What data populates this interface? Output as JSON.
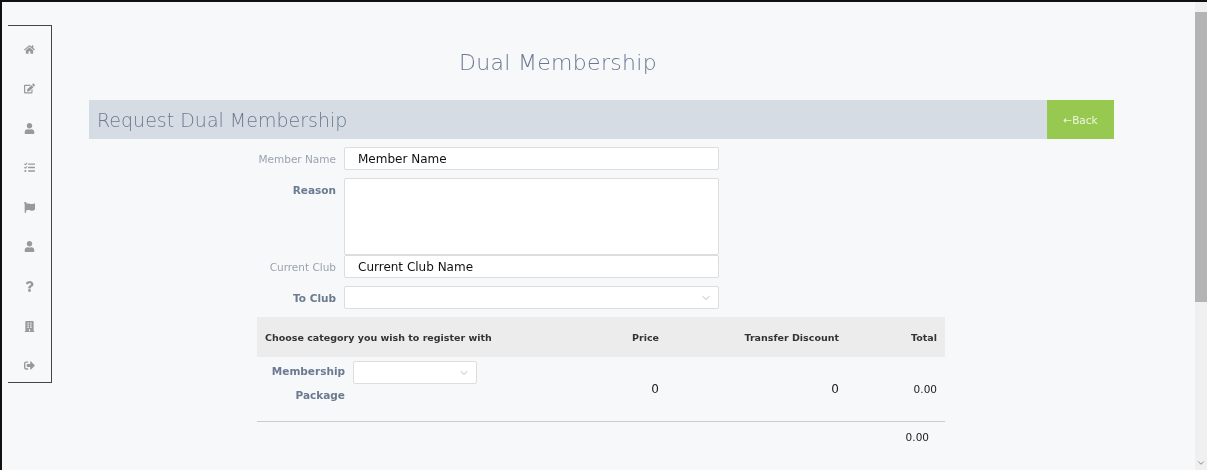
{
  "page_title": "Dual Membership",
  "section": {
    "title": "Request Dual Membership",
    "back_button": "←Back"
  },
  "form": {
    "fields": [
      {
        "label": "Member Name",
        "kind": "text",
        "value": "Member Name",
        "bold": false
      },
      {
        "label": "Reason",
        "kind": "textarea",
        "bold": true
      },
      {
        "label": "Current Club",
        "kind": "text",
        "value": "Current Club Name",
        "bold": false
      },
      {
        "label": "To Club",
        "kind": "select",
        "bold": true
      }
    ]
  },
  "table": {
    "columns": [
      "Choose category you wish to register with",
      "Price",
      "Transfer Discount",
      "Total"
    ],
    "rows": [
      {
        "label": "Membership Package",
        "price": "0",
        "discount": "0",
        "total": "0.00"
      }
    ],
    "grand_total": "0.00"
  }
}
